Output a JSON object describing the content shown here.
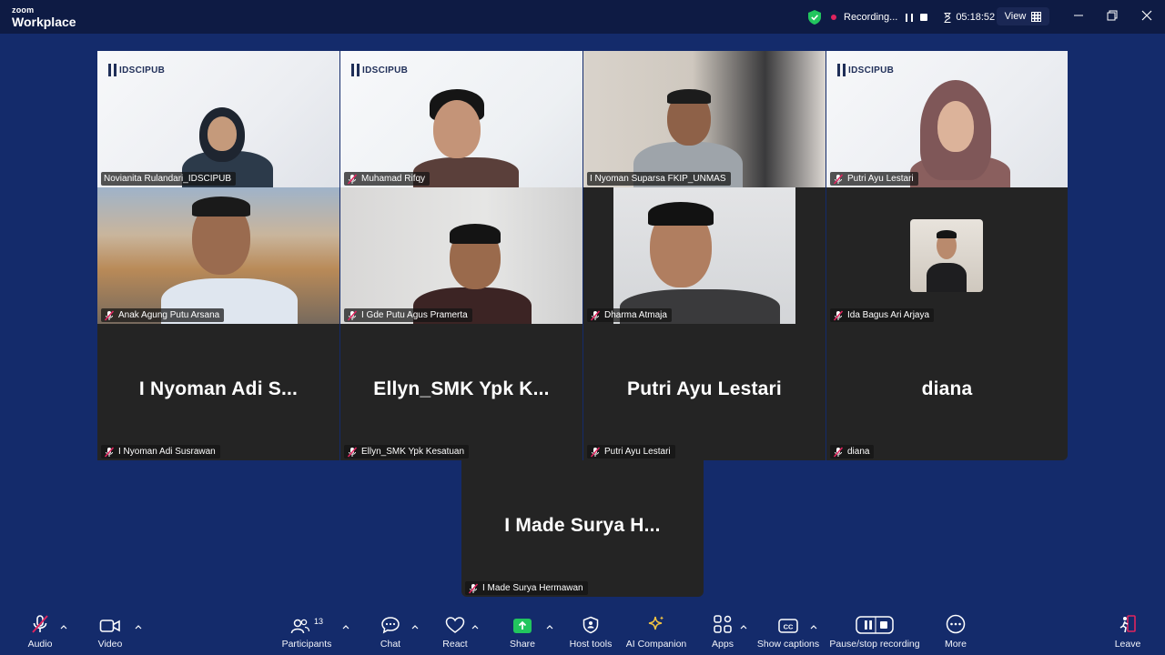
{
  "app": {
    "brand_small": "zoom",
    "brand_big": "Workplace"
  },
  "titlebar": {
    "recording_label": "Recording...",
    "timer": "05:18:52",
    "view_label": "View"
  },
  "colors": {
    "background": "#142b6b",
    "titlebar": "#0e1b44",
    "tile": "#242424",
    "active_speaker": "#35e09b",
    "muted": "#e0245e",
    "share_green": "#22c55e"
  },
  "tiles": [
    {
      "name": "Novianita Rulandari_IDSCIPUB",
      "video": true,
      "muted": false,
      "active": true,
      "logo": "IDSCIPUB"
    },
    {
      "name": "Muhamad Rifqy",
      "video": true,
      "muted": true,
      "logo": "IDSCIPUB"
    },
    {
      "name": "I Nyoman Suparsa FKIP_UNMAS",
      "video": true,
      "muted": false
    },
    {
      "name": "Putri Ayu Lestari",
      "video": true,
      "muted": true,
      "logo": "IDSCIPUB"
    },
    {
      "name": "Anak Agung Putu Arsana",
      "video": true,
      "muted": true
    },
    {
      "name": "I Gde Putu Agus Pramerta",
      "video": true,
      "muted": true
    },
    {
      "name": "Dharma Atmaja",
      "video": true,
      "muted": true
    },
    {
      "name": "Ida Bagus Ari Arjaya",
      "video": false,
      "avatar": true,
      "muted": true
    },
    {
      "name": "I Nyoman Adi Susrawan",
      "display": "I Nyoman Adi S...",
      "video": false,
      "muted": true
    },
    {
      "name": "Ellyn_SMK Ypk Kesatuan",
      "display": "Ellyn_SMK Ypk K...",
      "video": false,
      "muted": true
    },
    {
      "name": "Putri Ayu Lestari",
      "display": "Putri Ayu Lestari",
      "video": false,
      "muted": true
    },
    {
      "name": "diana",
      "display": "diana",
      "video": false,
      "muted": true
    },
    {
      "name": "I Made Surya Hermawan",
      "display": "I Made Surya H...",
      "video": false,
      "muted": true
    }
  ],
  "toolbar": {
    "audio": "Audio",
    "video": "Video",
    "participants": "Participants",
    "participants_count": "13",
    "chat": "Chat",
    "react": "React",
    "share": "Share",
    "host_tools": "Host tools",
    "ai_companion": "AI Companion",
    "apps": "Apps",
    "show_captions": "Show captions",
    "pause_stop_recording": "Pause/stop recording",
    "more": "More",
    "leave": "Leave"
  }
}
